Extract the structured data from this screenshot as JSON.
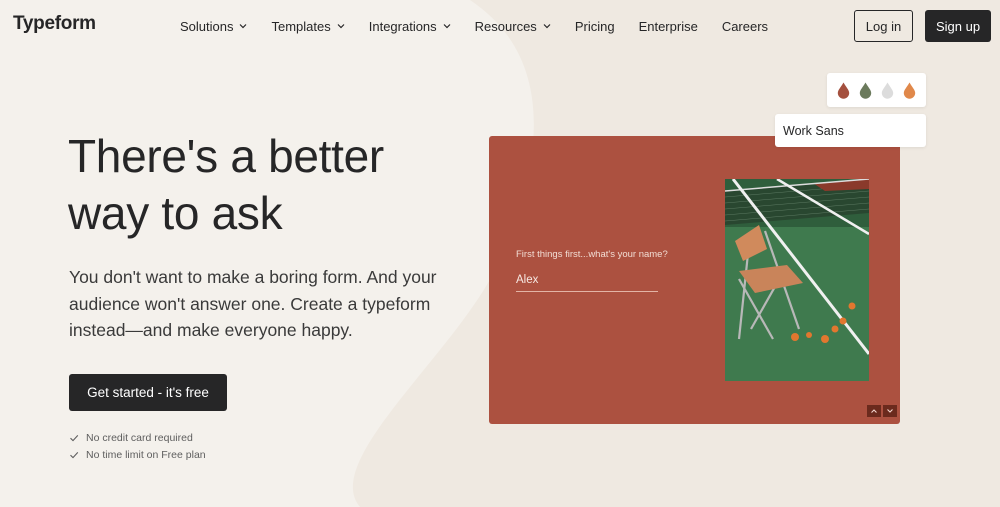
{
  "brand": {
    "name": "Typeform"
  },
  "nav": {
    "items": [
      {
        "label": "Solutions",
        "has_dropdown": true
      },
      {
        "label": "Templates",
        "has_dropdown": true
      },
      {
        "label": "Integrations",
        "has_dropdown": true
      },
      {
        "label": "Resources",
        "has_dropdown": true
      },
      {
        "label": "Pricing",
        "has_dropdown": false
      },
      {
        "label": "Enterprise",
        "has_dropdown": false
      },
      {
        "label": "Careers",
        "has_dropdown": false
      }
    ],
    "login_label": "Log in",
    "signup_label": "Sign up"
  },
  "hero": {
    "headline_line1": "There's a better",
    "headline_line2": "way to ask",
    "subtext": "You don't want to make a boring form. And your audience won't answer one. Create a typeform instead—and make everyone happy.",
    "cta_label": "Get started - it's free",
    "perks": [
      "No credit card required",
      "No time limit on Free plan"
    ]
  },
  "preview": {
    "question": "First things first...what's your name?",
    "answer": "Alex",
    "background_color": "#ac5140",
    "font_name": "Work Sans",
    "swatch_colors": [
      "#a4503e",
      "#6b7a5c",
      "#dcdcdc",
      "#e0884a"
    ],
    "up_icon": "chevron-up-icon",
    "down_icon": "chevron-down-icon"
  },
  "colors": {
    "page_bg": "#f4f1ec",
    "blob": "#efe9e1",
    "text": "#262627",
    "button_dark": "#262627"
  }
}
